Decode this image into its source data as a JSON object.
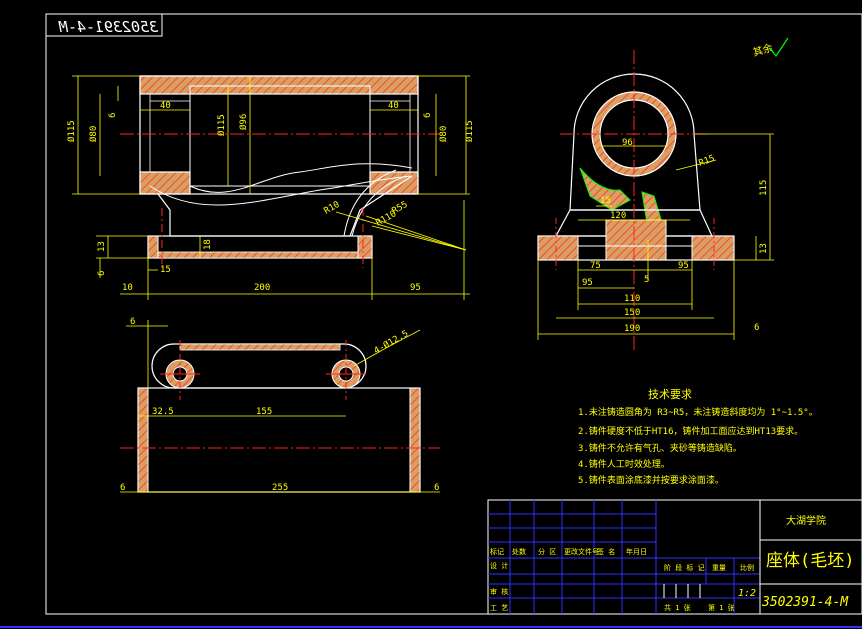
{
  "drawing_number_top": "3502391-4-M",
  "roughness_note": "其余",
  "notes": {
    "title": "技术要求",
    "items": [
      "1.未注铸造圆角为 R3~R5，未注铸造斜度均为 1°~1.5°。",
      "2.铸件硬度不低于HT16，铸件加工面应达到HT13要求。",
      "3.铸件不允许有气孔、夹砂等铸造缺陷。",
      "4.铸件人工时效处理。",
      "5.铸件表面涂底漆并按要求涂面漆。"
    ]
  },
  "dims": {
    "front": [
      "Ø115",
      "Ø80",
      "6",
      "40",
      "Ø115",
      "Ø96",
      "40",
      "6",
      "Ø80",
      "Ø115",
      "R10",
      "R55",
      "R110",
      "13",
      "18",
      "6",
      "15",
      "10",
      "200",
      "95"
    ],
    "side": [
      "96",
      "R15",
      "15",
      "120",
      "115",
      "75",
      "5",
      "95",
      "95",
      "110",
      "150",
      "190",
      "6",
      "13"
    ],
    "top": [
      "6",
      "4-Ø12.5",
      "32.5",
      "155",
      "255",
      "6",
      "6"
    ]
  },
  "title_block": {
    "school": "大湖学院",
    "part_name": "座体(毛坯)",
    "drawing_number": "3502391-4-M",
    "scale": "1:2",
    "sheet": "第 1 张",
    "header_cells": [
      "标记",
      "处数",
      "分 区",
      "更改文件号",
      "签 名",
      "年月日"
    ],
    "row_cells": [
      "设 计",
      "审 核",
      "工 艺"
    ],
    "right_cells": [
      "阶 段 标 记",
      "重量",
      "比例",
      "共 1 张"
    ]
  },
  "colors": {
    "background": "#000000",
    "outline": "#ffffff",
    "dimension": "#ffff00",
    "center_line": "#ff2222",
    "hatch_fill": "#d8a060",
    "hatch_line": "#ff3030",
    "green": "#00ff00",
    "table_line": "#3030ff"
  }
}
